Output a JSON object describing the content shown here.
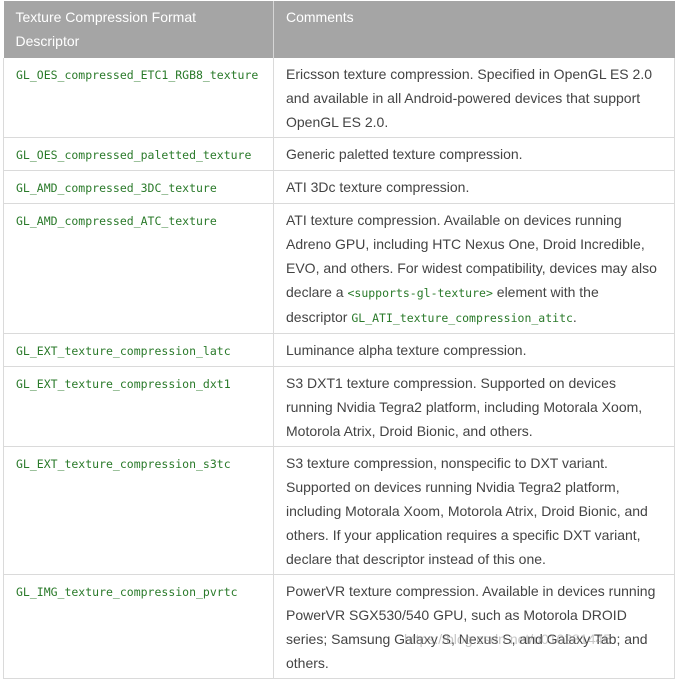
{
  "table": {
    "headers": {
      "format": "Texture Compression Format Descriptor",
      "comments": "Comments"
    },
    "rows": [
      {
        "format": "GL_OES_compressed_ETC1_RGB8_texture",
        "comment": "Ericsson texture compression. Specified in OpenGL ES 2.0 and available in all Android-powered devices that support OpenGL ES 2.0."
      },
      {
        "format": "GL_OES_compressed_paletted_texture",
        "comment": "Generic paletted texture compression."
      },
      {
        "format": "GL_AMD_compressed_3DC_texture",
        "comment": "ATI 3Dc texture compression."
      },
      {
        "format": "GL_AMD_compressed_ATC_texture",
        "comment_before": "ATI texture compression. Available on devices running Adreno GPU, including HTC Nexus One, Droid Incredible, EVO, and others. For widest compatibility, devices may also declare a ",
        "comment_code1": "<supports-gl-texture>",
        "comment_middle": " element with the descriptor ",
        "comment_code2": "GL_ATI_texture_compression_atitc",
        "comment_after": "."
      },
      {
        "format": "GL_EXT_texture_compression_latc",
        "comment": "Luminance alpha texture compression."
      },
      {
        "format": "GL_EXT_texture_compression_dxt1",
        "comment": "S3 DXT1 texture compression. Supported on devices running Nvidia Tegra2 platform, including Motorala Xoom, Motorola Atrix, Droid Bionic, and others."
      },
      {
        "format": "GL_EXT_texture_compression_s3tc",
        "comment": "S3 texture compression, nonspecific to DXT variant. Supported on devices running Nvidia Tegra2 platform, including Motorala Xoom, Motorola Atrix, Droid Bionic, and others. If your application requires a specific DXT variant, declare that descriptor instead of this one."
      },
      {
        "format": "GL_IMG_texture_compression_pvrtc",
        "comment": "PowerVR texture compression. Available in devices running PowerVR SGX530/540 GPU, such as Motorola DROID series; Samsung Galaxy S, Nexus S, and Galaxy Tab; and others."
      }
    ]
  },
  "watermark": "https://blog.csdn.net/u010281445"
}
